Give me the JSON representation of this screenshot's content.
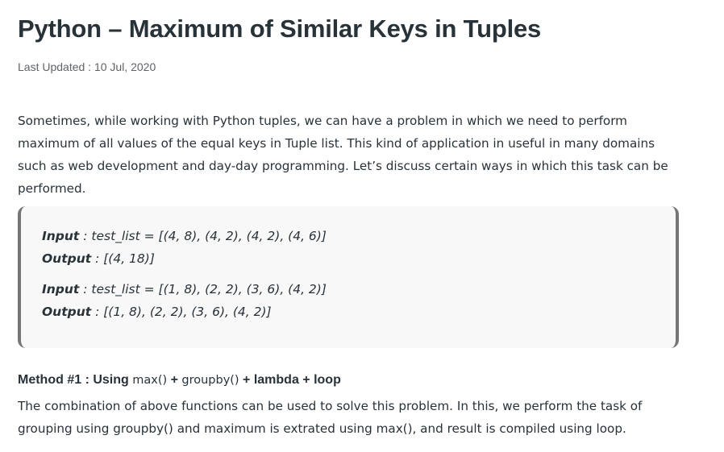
{
  "article": {
    "title": "Python – Maximum of Similar Keys in Tuples",
    "last_updated": "Last Updated : 10 Jul, 2020",
    "intro": "Sometimes, while working with Python tuples, we can have a problem in which we need to perform maximum of all values of the equal keys in Tuple list. This kind of application in useful in many domains such as web development and day-day programming. Let’s discuss certain ways in which this task can be performed."
  },
  "examples": [
    {
      "input_label": "Input",
      "input_value": " : test_list = [(4, 8), (4, 2), (4, 2), (4, 6)]",
      "output_label": "Output",
      "output_value": " : [(4, 18)]"
    },
    {
      "input_label": "Input",
      "input_value": " : test_list = [(1, 8), (2, 2), (3, 6), (4, 2)]",
      "output_label": "Output",
      "output_value": " : [(1, 8), (2, 2), (3, 6), (4, 2)]"
    }
  ],
  "method": {
    "heading_prefix": "Method #1 : Using ",
    "heading_code1": "max()",
    "heading_plus1": " + ",
    "heading_code2": "groupby()",
    "heading_suffix": " + lambda + loop",
    "description": "The combination of above functions can be used to solve this problem. In this, we perform the task of grouping using groupby() and maximum is extrated using max(), and result is compiled using loop."
  }
}
